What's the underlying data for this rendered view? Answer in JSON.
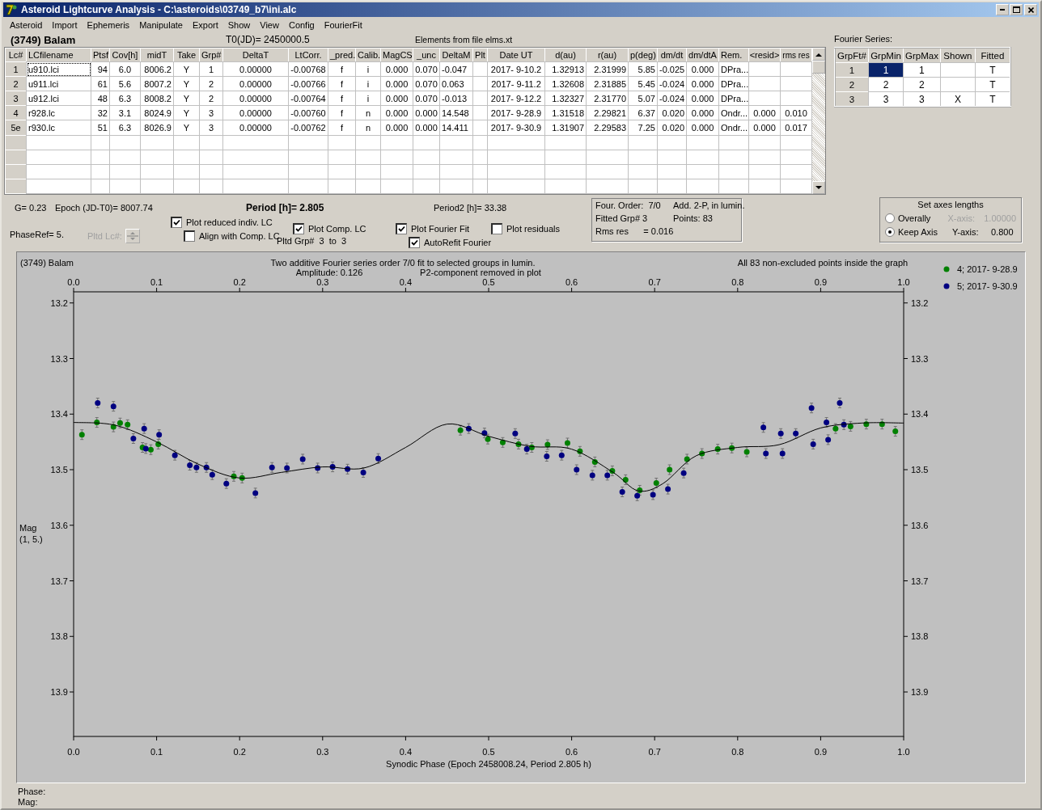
{
  "window": {
    "title": "Asteroid Lightcurve Analysis - C:\\asteroids\\03749_b7\\ini.alc"
  },
  "menu": [
    "Asteroid",
    "Import",
    "Ephemeris",
    "Manipulate",
    "Export",
    "Show",
    "View",
    "Config",
    "FourierFit"
  ],
  "header": {
    "asteroid": "(3749) Balam",
    "t0": "T0(JD)= 2450000.5",
    "elements": "Elements from file elms.xt"
  },
  "lc_table": {
    "columns": [
      "Lc#",
      "LCfilename",
      "Ptsf",
      "Cov[h]",
      "midT",
      "Take",
      "Grp#",
      "DeltaT",
      "LtCorr.",
      "_pred.",
      "Calib.",
      "MagCS",
      "_unc",
      "DeltaM",
      "Plt",
      "Date UT",
      "d(au)",
      "r(au)",
      "p(deg)",
      "dm/dt",
      "dm/dtA",
      "Rem.",
      "<resid>",
      "rms res"
    ],
    "rows": [
      {
        "focused": true,
        "cells": [
          "1",
          "u910.lci",
          "94",
          "6.0",
          "8006.2",
          "Y",
          "1",
          "0.00000",
          "-0.00768",
          "f",
          "i",
          "0.000",
          "0.070",
          "-0.047",
          "",
          "2017- 9-10.2",
          "1.32913",
          "2.31999",
          "5.85",
          "-0.025",
          "0.000",
          "DPra...",
          "",
          ""
        ]
      },
      {
        "focused": false,
        "cells": [
          "2",
          "u911.lci",
          "61",
          "5.6",
          "8007.2",
          "Y",
          "2",
          "0.00000",
          "-0.00766",
          "f",
          "i",
          "0.000",
          "0.070",
          "0.063",
          "",
          "2017- 9-11.2",
          "1.32608",
          "2.31885",
          "5.45",
          "-0.024",
          "0.000",
          "DPra...",
          "",
          ""
        ]
      },
      {
        "focused": false,
        "cells": [
          "3",
          "u912.lci",
          "48",
          "6.3",
          "8008.2",
          "Y",
          "2",
          "0.00000",
          "-0.00764",
          "f",
          "i",
          "0.000",
          "0.070",
          "-0.013",
          "",
          "2017- 9-12.2",
          "1.32327",
          "2.31770",
          "5.07",
          "-0.024",
          "0.000",
          "DPra...",
          "",
          ""
        ]
      },
      {
        "focused": false,
        "cells": [
          "4",
          "r928.lc",
          "32",
          "3.1",
          "8024.9",
          "Y",
          "3",
          "0.00000",
          "-0.00760",
          "f",
          "n",
          "0.000",
          "0.000",
          "14.548",
          "",
          "2017- 9-28.9",
          "1.31518",
          "2.29821",
          "6.37",
          "0.020",
          "0.000",
          "Ondr...",
          "0.000",
          "0.010"
        ]
      },
      {
        "focused": false,
        "cells": [
          "5e",
          "r930.lc",
          "51",
          "6.3",
          "8026.9",
          "Y",
          "3",
          "0.00000",
          "-0.00762",
          "f",
          "n",
          "0.000",
          "0.000",
          "14.411",
          "",
          "2017- 9-30.9",
          "1.31907",
          "2.29583",
          "7.25",
          "0.020",
          "0.000",
          "Ondr...",
          "0.000",
          "0.017"
        ]
      }
    ]
  },
  "fourier_series": {
    "label": "Fourier Series:",
    "columns": [
      "GrpFt#",
      "GrpMin",
      "GrpMax",
      "Shown",
      "Fitted"
    ],
    "rows": [
      {
        "cells": [
          {
            "text": "1",
            "selected": false
          },
          {
            "text": "1",
            "selected": true
          },
          {
            "text": "1",
            "selected": false
          },
          {
            "selected": false
          },
          {
            "text": "T",
            "selected": false
          }
        ]
      },
      {
        "cells": [
          {
            "text": "2",
            "selected": false
          },
          {
            "text": "2",
            "selected": false
          },
          {
            "text": "2",
            "selected": false
          },
          {
            "selected": false
          },
          {
            "text": "T",
            "selected": false
          }
        ]
      },
      {
        "cells": [
          {
            "text": "3",
            "selected": false
          },
          {
            "text": "3",
            "selected": false
          },
          {
            "text": "3",
            "selected": false
          },
          {
            "text": "X",
            "selected": false
          },
          {
            "text": "T",
            "selected": false
          }
        ]
      }
    ]
  },
  "parameters": {
    "g": "G= 0.23",
    "epoch": "Epoch (JD-T0)= 8007.74",
    "period": "Period [h]= 2.805",
    "period2": "Period2 [h]= 33.38",
    "phase_ref": "PhaseRef= 5.",
    "pltd_lc": {
      "label": "Pltd Lc#:",
      "disabled": true
    }
  },
  "option_columns": [
    {
      "checkboxes": [
        {
          "label": "Plot reduced indiv. LC",
          "checked": true
        },
        {
          "label": "Align with Comp. LC",
          "checked": false
        }
      ]
    },
    {
      "checkboxes": [
        {
          "label": "Plot Comp. LC",
          "checked": true
        }
      ],
      "note": "Pltd Grp#  3  to  3"
    },
    {
      "checkboxes": [
        {
          "label": "Plot Fourier Fit",
          "checked": true
        },
        {
          "label": "AutoRefit Fourier",
          "checked": true
        }
      ]
    },
    {
      "checkboxes": [
        {
          "label": "Plot residuals",
          "checked": false
        }
      ]
    }
  ],
  "fit_info": {
    "lines": [
      [
        "Four. Order:  7/0",
        "Add. 2-P, in lumin."
      ],
      [
        "Fitted Grp# 3",
        "Points: 83"
      ],
      [
        "Rms res      = 0.016"
      ]
    ]
  },
  "axes_lengths": {
    "title": "Set axes lengths",
    "options": [
      {
        "label": "Overally",
        "selected": false,
        "axis_label": "X-axis:",
        "axis_value": "1.00000",
        "disabled": true
      },
      {
        "label": "Keep Axis",
        "selected": true,
        "axis_label": "Y-axis:",
        "axis_value": "0.800",
        "disabled": false
      }
    ]
  },
  "plot": {
    "object": "(3749) Balam",
    "title": "Two additive Fourier series order 7/0 fit to selected groups in lumin.",
    "amplitude": "Amplitude: 0.126",
    "p2_note": "P2-component removed in plot",
    "note": "All 83 non-excluded points inside the graph",
    "ylabel_note": "(1, 5.)",
    "right_axis_labels": [
      "13.2",
      "13.3",
      "13.4",
      "13.5",
      "13.6",
      "13.7",
      "13.8",
      "13.9"
    ],
    "chart_data": {
      "type": "scatter",
      "legend": "right",
      "xlabel": "Synodic Phase (Epoch 2458008.24, Period 2.805 h)",
      "ylabel": "Mag",
      "xlim": [
        0,
        1
      ],
      "ylim": [
        13.98,
        13.18
      ],
      "xticks": [
        {
          "value": 0,
          "label": "0.0"
        },
        {
          "value": 0.1,
          "label": "0.1"
        },
        {
          "value": 0.2,
          "label": "0.2"
        },
        {
          "value": 0.3,
          "label": "0.3"
        },
        {
          "value": 0.4,
          "label": "0.4"
        },
        {
          "value": 0.5,
          "label": "0.5"
        },
        {
          "value": 0.6,
          "label": "0.6"
        },
        {
          "value": 0.7,
          "label": "0.7"
        },
        {
          "value": 0.8,
          "label": "0.8"
        },
        {
          "value": 0.9,
          "label": "0.9"
        },
        {
          "value": 1,
          "label": "1.0"
        }
      ],
      "yticks": [
        13.2,
        13.3,
        13.4,
        13.5,
        13.6,
        13.7,
        13.8,
        13.9
      ],
      "series": [
        {
          "name": "4; 2017- 9-28.9",
          "color": "#008000",
          "x": [
            0.01,
            0.028,
            0.048,
            0.056,
            0.065,
            0.083,
            0.093,
            0.102,
            0.193,
            0.203,
            0.466,
            0.499,
            0.517,
            0.536,
            0.552,
            0.571,
            0.595,
            0.61,
            0.628,
            0.649,
            0.665,
            0.682,
            0.702,
            0.718,
            0.739,
            0.757,
            0.776,
            0.793,
            0.811,
            0.918,
            0.936,
            0.955,
            0.974,
            0.99
          ],
          "values": [
            13.437,
            13.415,
            13.423,
            13.416,
            13.419,
            13.46,
            13.464,
            13.454,
            13.512,
            13.515,
            13.429,
            13.445,
            13.451,
            13.454,
            13.46,
            13.455,
            13.452,
            13.467,
            13.486,
            13.502,
            13.518,
            13.537,
            13.524,
            13.5,
            13.481,
            13.471,
            13.463,
            13.461,
            13.468,
            13.426,
            13.422,
            13.418,
            13.418,
            13.431
          ]
        },
        {
          "name": "5; 2017- 9-30.9",
          "color": "#000080",
          "x": [
            0.029,
            0.048,
            0.072,
            0.085,
            0.087,
            0.103,
            0.122,
            0.14,
            0.148,
            0.16,
            0.167,
            0.184,
            0.219,
            0.239,
            0.257,
            0.276,
            0.294,
            0.312,
            0.33,
            0.349,
            0.367,
            0.476,
            0.495,
            0.532,
            0.546,
            0.57,
            0.588,
            0.606,
            0.625,
            0.643,
            0.661,
            0.679,
            0.698,
            0.716,
            0.735,
            0.831,
            0.834,
            0.852,
            0.854,
            0.87,
            0.889,
            0.891,
            0.907,
            0.909,
            0.923,
            0.928
          ],
          "values": [
            13.38,
            13.386,
            13.444,
            13.426,
            13.462,
            13.437,
            13.474,
            13.492,
            13.496,
            13.496,
            13.509,
            13.525,
            13.542,
            13.496,
            13.497,
            13.481,
            13.497,
            13.495,
            13.499,
            13.505,
            13.48,
            13.426,
            13.434,
            13.435,
            13.463,
            13.476,
            13.474,
            13.5,
            13.51,
            13.51,
            13.54,
            13.547,
            13.545,
            13.535,
            13.506,
            13.424,
            13.471,
            13.435,
            13.471,
            13.435,
            13.389,
            13.454,
            13.415,
            13.446,
            13.38,
            13.419
          ]
        },
        {
          "type": "line",
          "color": "#000000",
          "x": [
            0,
            0.05,
            0.1,
            0.15,
            0.2,
            0.25,
            0.3,
            0.35,
            0.4,
            0.45,
            0.5,
            0.55,
            0.6,
            0.65,
            0.68,
            0.71,
            0.75,
            0.8,
            0.85,
            0.9,
            0.95,
            1
          ],
          "values": [
            13.415,
            13.42,
            13.45,
            13.49,
            13.515,
            13.505,
            13.495,
            13.497,
            13.46,
            13.418,
            13.44,
            13.458,
            13.463,
            13.505,
            13.538,
            13.525,
            13.475,
            13.46,
            13.455,
            13.425,
            13.416,
            13.416
          ]
        }
      ]
    }
  },
  "status": {
    "phase": "Phase:",
    "mag": "Mag:"
  }
}
